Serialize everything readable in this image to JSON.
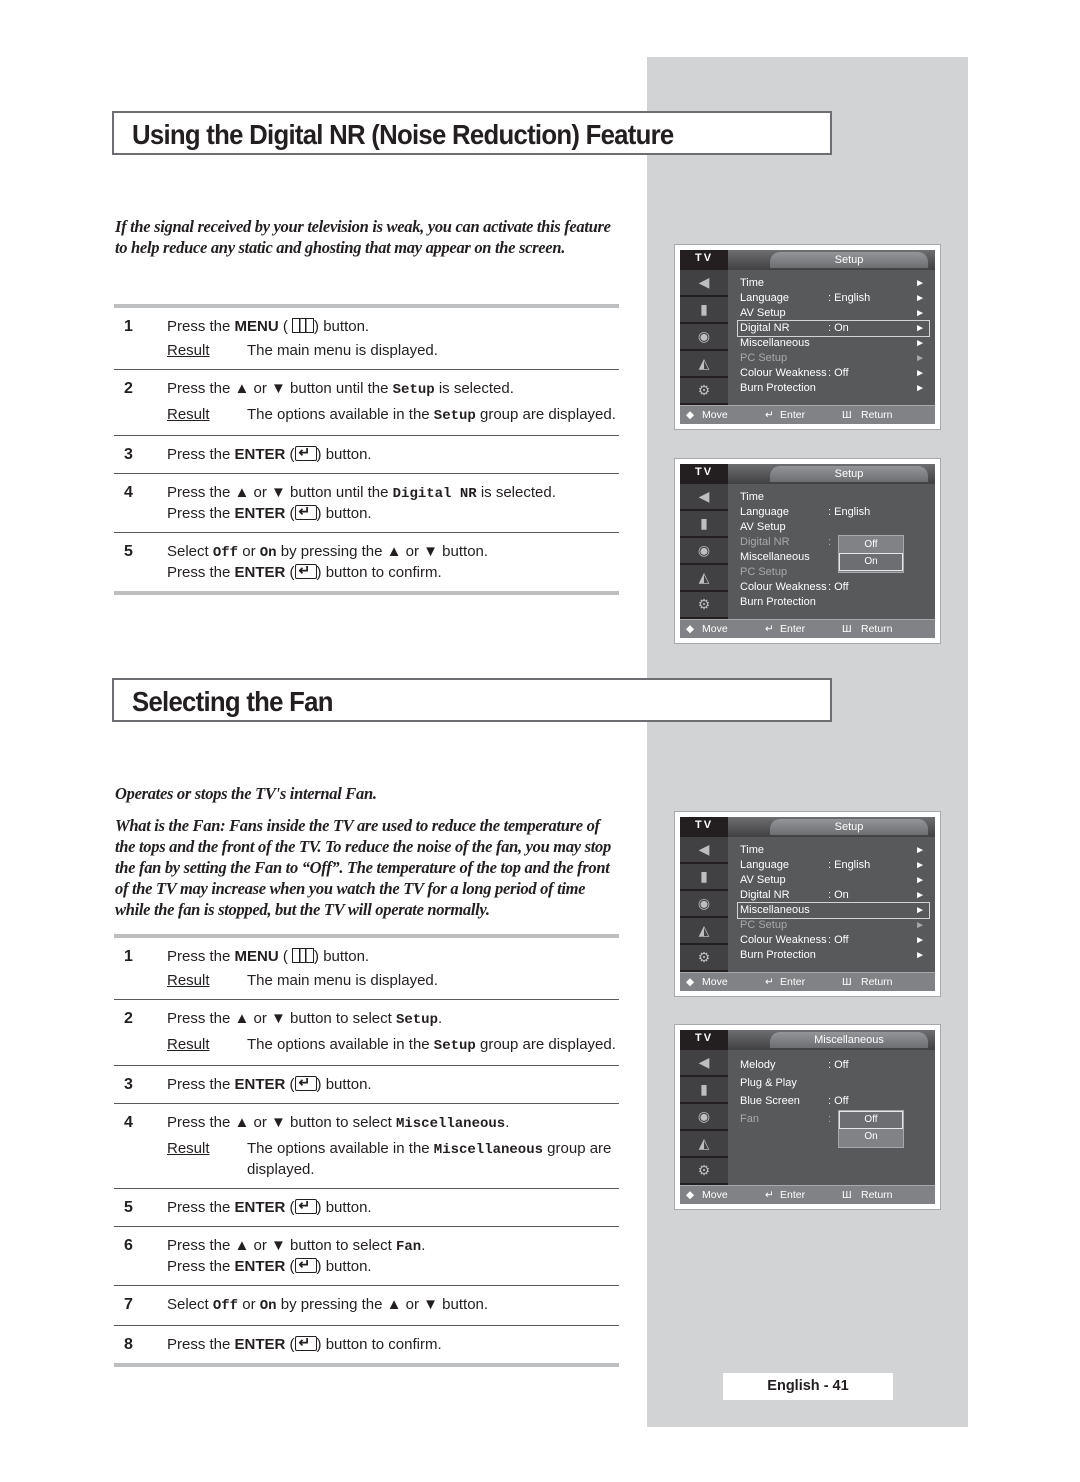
{
  "section1": {
    "title": "Using the Digital NR (Noise Reduction) Feature",
    "intro": "If the signal received by your television is weak, you can activate this feature to help reduce any static and ghosting that may appear on the screen.",
    "steps": [
      {
        "num": "1",
        "pre": "Press the ",
        "bold": "MENU",
        "post_icon": "menu-icon",
        "post": " button.",
        "result_label": "Result",
        "result": "The main menu is displayed."
      },
      {
        "num": "2",
        "text_a": "Press the ▲ or ▼ button until the ",
        "mono": "Setup",
        "text_b": " is selected.",
        "result_label": "Result",
        "result_a": "The options available in the ",
        "result_mono": "Setup",
        "result_b": " group are displayed."
      },
      {
        "num": "3",
        "pre": "Press the ",
        "bold": "ENTER",
        "post": " button."
      },
      {
        "num": "4",
        "text_a": "Press the ▲ or ▼ button until the ",
        "mono": "Digital NR",
        "text_b": " is selected.",
        "line2_pre": "Press the ",
        "line2_bold": "ENTER",
        "line2_post": " button."
      },
      {
        "num": "5",
        "text_a": "Select ",
        "mono1": "Off",
        "mid": " or ",
        "mono2": "On",
        "text_b": "  by pressing the ▲ or ▼ button.",
        "line2_pre": "Press the ",
        "line2_bold": "ENTER",
        "line2_post": " button to confirm."
      }
    ]
  },
  "section2": {
    "title": "Selecting the Fan",
    "subtitle": "Operates or stops the TV's internal Fan.",
    "intro": "What is the Fan: Fans inside the TV are used to reduce the temperature of the tops and the front of the TV. To reduce the noise of the fan, you may stop the fan by setting the Fan to “Off”. The temperature of the top and the front of the TV may increase when you watch the TV for a long period of time while the fan is stopped, but the TV will operate normally.",
    "steps": [
      {
        "num": "1",
        "pre": "Press the ",
        "bold": "MENU",
        "post": " button.",
        "result_label": "Result",
        "result": "The main menu is displayed."
      },
      {
        "num": "2",
        "text_a": "Press the ▲ or ▼ button to select ",
        "mono": "Setup",
        "text_b": ".",
        "result_label": "Result",
        "result_a": "The options available in the ",
        "result_mono": "Setup",
        "result_b": " group are displayed."
      },
      {
        "num": "3",
        "pre": "Press the ",
        "bold": "ENTER",
        "post": " button."
      },
      {
        "num": "4",
        "text_a": "Press the ▲ or ▼ button to select  ",
        "mono": "Miscellaneous",
        "text_b": ".",
        "result_label": "Result",
        "result_a": "The options available in the ",
        "result_mono": "Miscellaneous",
        "result_b": " group are displayed."
      },
      {
        "num": "5",
        "pre": "Press the ",
        "bold": "ENTER",
        "post": " button."
      },
      {
        "num": "6",
        "text_a": "Press the ▲ or ▼ button to select ",
        "mono": "Fan",
        "text_b": ".",
        "line2_pre": "Press the ",
        "line2_bold": "ENTER",
        "line2_post": " button."
      },
      {
        "num": "7",
        "text_a": "Select ",
        "mono1": "Off",
        "mid": " or ",
        "mono2": "On",
        "text_b": " by pressing the ▲ or ▼ button."
      },
      {
        "num": "8",
        "pre": "Press the ",
        "bold": "ENTER",
        "post": " button to confirm."
      }
    ]
  },
  "osd": {
    "tv_label": "TV",
    "footer": {
      "move": "Move",
      "enter": "Enter",
      "return": "Return"
    },
    "screens": [
      {
        "header": "Setup",
        "rows": [
          {
            "label": "Time",
            "val": "",
            "arrow": "►"
          },
          {
            "label": "Language",
            "val": ":  English",
            "arrow": "►"
          },
          {
            "label": "AV Setup",
            "val": "",
            "arrow": "►"
          },
          {
            "label": "Digital NR",
            "val": ":  On",
            "arrow": "►"
          },
          {
            "label": "Miscellaneous",
            "val": "",
            "arrow": "►"
          },
          {
            "label": "PC Setup",
            "val": "",
            "arrow": "►"
          },
          {
            "label": "Colour Weakness",
            "val": ":  Off",
            "arrow": "►"
          },
          {
            "label": "Burn Protection",
            "val": "",
            "arrow": "►"
          }
        ]
      },
      {
        "header": "Setup",
        "rows": [
          {
            "label": "Time",
            "val": "",
            "arrow": ""
          },
          {
            "label": "Language",
            "val": ":  English",
            "arrow": ""
          },
          {
            "label": "AV Setup",
            "val": "",
            "arrow": ""
          },
          {
            "label": "Digital NR",
            "val": ":",
            "arrow": ""
          },
          {
            "label": "Miscellaneous",
            "val": "",
            "arrow": ""
          },
          {
            "label": "PC Setup",
            "val": "",
            "arrow": ""
          },
          {
            "label": "Colour Weakness",
            "val": ":  Off",
            "arrow": ""
          },
          {
            "label": "Burn Protection",
            "val": "",
            "arrow": ""
          }
        ],
        "popup": [
          "Off",
          "On"
        ]
      },
      {
        "header": "Setup",
        "rows": [
          {
            "label": "Time",
            "val": "",
            "arrow": "►"
          },
          {
            "label": "Language",
            "val": ":  English",
            "arrow": "►"
          },
          {
            "label": "AV Setup",
            "val": "",
            "arrow": "►"
          },
          {
            "label": "Digital NR",
            "val": ":  On",
            "arrow": "►"
          },
          {
            "label": "Miscellaneous",
            "val": "",
            "arrow": "►"
          },
          {
            "label": "PC Setup",
            "val": "",
            "arrow": "►"
          },
          {
            "label": "Colour Weakness",
            "val": ":  Off",
            "arrow": "►"
          },
          {
            "label": "Burn Protection",
            "val": "",
            "arrow": "►"
          }
        ]
      },
      {
        "header": "Miscellaneous",
        "rows": [
          {
            "label": "Melody",
            "val": ":  Off",
            "arrow": ""
          },
          {
            "label": "Plug & Play",
            "val": "",
            "arrow": ""
          },
          {
            "label": "Blue Screen",
            "val": ":  Off",
            "arrow": ""
          },
          {
            "label": "Fan",
            "val": ":",
            "arrow": ""
          }
        ],
        "popup": [
          "Off",
          "On"
        ]
      }
    ]
  },
  "footer": {
    "page_label": "English - 41"
  }
}
